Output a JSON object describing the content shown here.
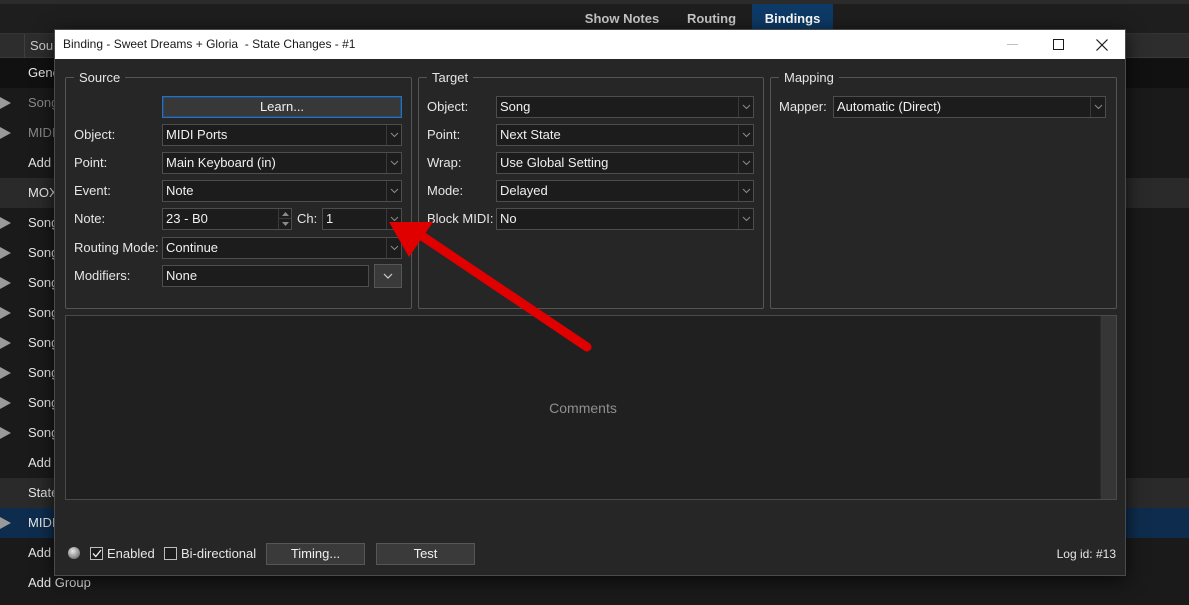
{
  "app": {
    "tabs": [
      {
        "label": "Show Notes",
        "active": false
      },
      {
        "label": "Routing",
        "active": false
      },
      {
        "label": "Bindings",
        "active": true
      }
    ],
    "list_header": "Sou",
    "rows": [
      {
        "label": "Gene",
        "style": "dark"
      },
      {
        "label": "Song",
        "style": "dim",
        "expand": true
      },
      {
        "label": "MIDI",
        "style": "dim",
        "expand": true
      },
      {
        "label": "Add",
        "style": ""
      },
      {
        "label": "MOX",
        "style": "mid"
      },
      {
        "label": "Song",
        "style": "",
        "expand": true
      },
      {
        "label": "Song",
        "style": "",
        "expand": true
      },
      {
        "label": "Song",
        "style": "",
        "expand": true
      },
      {
        "label": "Song",
        "style": "",
        "expand": true
      },
      {
        "label": "Song",
        "style": "",
        "expand": true
      },
      {
        "label": "Song",
        "style": "",
        "expand": true
      },
      {
        "label": "Song",
        "style": "",
        "expand": true
      },
      {
        "label": "Song",
        "style": "",
        "expand": true
      },
      {
        "label": "Add",
        "style": ""
      },
      {
        "label": "State",
        "style": "mid"
      },
      {
        "label": "MIDI",
        "style": "hl",
        "expand": true
      },
      {
        "label": "Add",
        "style": ""
      },
      {
        "label": "Add Group",
        "style": ""
      }
    ]
  },
  "dialog": {
    "title": "Binding - Sweet Dreams + Gloria  - State Changes - #1",
    "source": {
      "legend": "Source",
      "learn_label": "Learn...",
      "object_label": "Object:",
      "object_value": "MIDI Ports",
      "point_label": "Point:",
      "point_value": "Main Keyboard (in)",
      "event_label": "Event:",
      "event_value": "Note",
      "note_label": "Note:",
      "note_value": "23 - B0",
      "ch_label": "Ch:",
      "ch_value": "1",
      "routing_label": "Routing Mode:",
      "routing_value": "Continue",
      "modifiers_label": "Modifiers:",
      "modifiers_value": "None"
    },
    "target": {
      "legend": "Target",
      "object_label": "Object:",
      "object_value": "Song",
      "point_label": "Point:",
      "point_value": "Next State",
      "wrap_label": "Wrap:",
      "wrap_value": "Use Global Setting",
      "mode_label": "Mode:",
      "mode_value": "Delayed",
      "block_label": "Block MIDI:",
      "block_value": "No"
    },
    "mapping": {
      "legend": "Mapping",
      "mapper_label": "Mapper:",
      "mapper_value": "Automatic (Direct)"
    },
    "comments_placeholder": "Comments",
    "footer": {
      "enabled_label": "Enabled",
      "enabled_checked": true,
      "bidirectional_label": "Bi-directional",
      "bidirectional_checked": false,
      "timing_label": "Timing...",
      "test_label": "Test",
      "log_id": "Log id: #13"
    }
  },
  "colors": {
    "annotation_arrow": "#e00000",
    "active_tab": "#0d3a66",
    "selected_row": "#0e2d4e"
  }
}
